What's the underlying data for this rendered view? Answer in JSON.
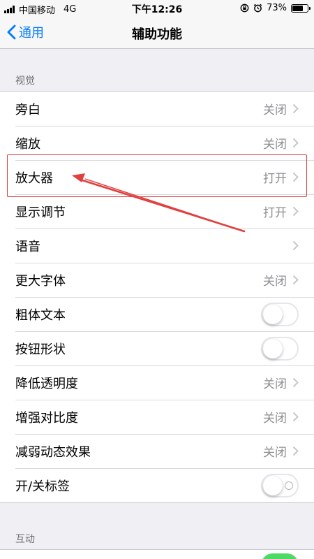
{
  "status_bar": {
    "carrier": "中国移动",
    "network": "4G",
    "time": "下午12:26",
    "battery_percent": "73%",
    "battery_level": 0.73
  },
  "nav": {
    "back_label": "通用",
    "title": "辅助功能"
  },
  "vision": {
    "header": "视觉",
    "items": [
      {
        "label": "旁白",
        "value": "关闭"
      },
      {
        "label": "缩放",
        "value": "关闭"
      },
      {
        "label": "放大器",
        "value": "打开"
      },
      {
        "label": "显示调节",
        "value": "打开"
      },
      {
        "label": "语音",
        "value": ""
      },
      {
        "label": "更大字体",
        "value": "关闭"
      },
      {
        "label": "粗体文本",
        "toggle": false
      },
      {
        "label": "按钮形状",
        "toggle": false
      },
      {
        "label": "降低透明度",
        "value": "关闭"
      },
      {
        "label": "增强对比度",
        "value": "关闭"
      },
      {
        "label": "减弱动态效果",
        "value": "关闭"
      },
      {
        "label": "开/关标签",
        "toggle": false
      }
    ]
  },
  "interaction": {
    "header": "互动"
  },
  "colors": {
    "accent": "#007aff",
    "annotation": "#e04040",
    "toggle_on": "#4cd964"
  }
}
